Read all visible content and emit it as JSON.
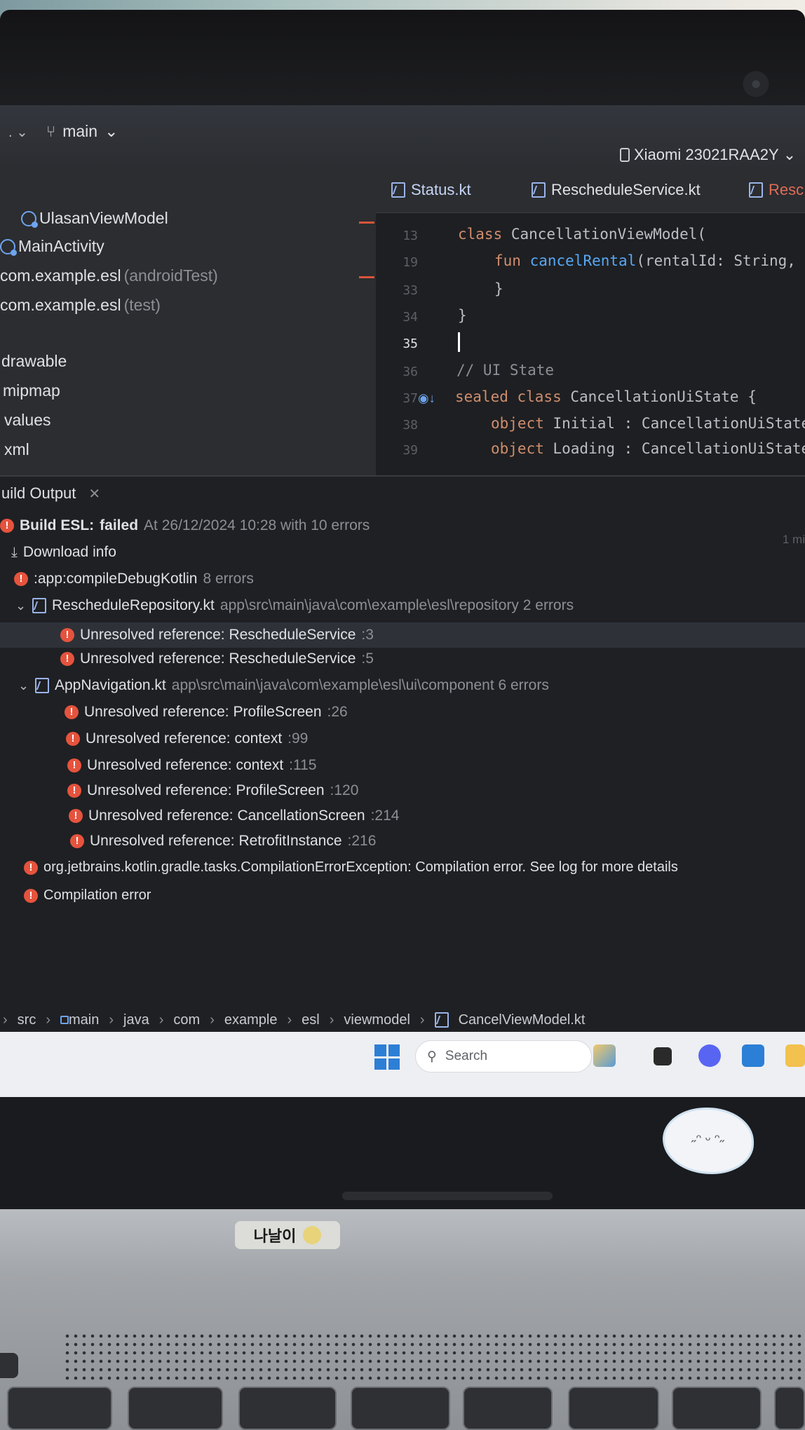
{
  "toolbar": {
    "branch": "main",
    "device": "Xiaomi 23021RAA2Y"
  },
  "project_tree": {
    "items": [
      {
        "label": "UlasanViewModel",
        "hint": ""
      },
      {
        "label": "MainActivity",
        "hint": ""
      },
      {
        "label": "com.example.esl",
        "hint": "(androidTest)"
      },
      {
        "label": "com.example.esl",
        "hint": "(test)"
      },
      {
        "label": "drawable",
        "hint": ""
      },
      {
        "label": "mipmap",
        "hint": ""
      },
      {
        "label": "values",
        "hint": ""
      },
      {
        "label": "xml",
        "hint": ""
      }
    ]
  },
  "editor": {
    "tabs": [
      "Status.kt",
      "RescheduleService.kt",
      "Resc"
    ],
    "gutter": [
      "13",
      "19",
      "33",
      "34",
      "35",
      "36",
      "37",
      "38",
      "39"
    ],
    "code": {
      "l13_kw": "class",
      "l13_rest": " CancellationViewModel(",
      "l19_kw": "fun",
      "l19_fn": "cancelRental",
      "l19_rest": "(rentalId: String,",
      "l33": "}",
      "l34": "}",
      "l36": "// UI State",
      "l37_kw": "sealed class",
      "l37_rest": " CancellationUiState {",
      "l38_kw": "object",
      "l38_rest": " Initial : CancellationUiState",
      "l39_kw": "object",
      "l39_rest": " Loading : CancellationUiState"
    }
  },
  "build_output": {
    "tab_label": "uild Output",
    "time_note": "1 mi",
    "summary": {
      "label": "Build ESL:",
      "status": "failed",
      "detail": "At 26/12/2024 10:28 with 10 errors"
    },
    "download_info": "Download info",
    "task": {
      "label": ":app:compileDebugKotlin",
      "count": "8 errors"
    },
    "files": [
      {
        "name": "RescheduleRepository.kt",
        "path": "app\\src\\main\\java\\com\\example\\esl\\repository 2 errors",
        "errors": [
          {
            "msg": "Unresolved reference: RescheduleService",
            "line": ":3"
          },
          {
            "msg": "Unresolved reference: RescheduleService",
            "line": ":5"
          }
        ]
      },
      {
        "name": "AppNavigation.kt",
        "path": "app\\src\\main\\java\\com\\example\\esl\\ui\\component 6 errors",
        "errors": [
          {
            "msg": "Unresolved reference: ProfileScreen",
            "line": ":26"
          },
          {
            "msg": "Unresolved reference: context",
            "line": ":99"
          },
          {
            "msg": "Unresolved reference: context",
            "line": ":115"
          },
          {
            "msg": "Unresolved reference: ProfileScreen",
            "line": ":120"
          },
          {
            "msg": "Unresolved reference: CancellationScreen",
            "line": ":214"
          },
          {
            "msg": "Unresolved reference: RetrofitInstance",
            "line": ":216"
          }
        ]
      }
    ],
    "exception": "org.jetbrains.kotlin.gradle.tasks.CompilationErrorException: Compilation error. See log for more details",
    "compilation_error": "Compilation error"
  },
  "breadcrumbs": [
    "src",
    "main",
    "java",
    "com",
    "example",
    "esl",
    "viewmodel",
    "CancelViewModel.kt"
  ],
  "taskbar": {
    "search_placeholder": "Search"
  },
  "laptop": {
    "name_sticker": "나날이"
  },
  "colors": {
    "error": "#e5533d",
    "keyword": "#cf8e6d",
    "function": "#56a8f5",
    "accent": "#6ea4ef"
  },
  "icons": [
    "branch-icon",
    "device-icon",
    "kotlin-class-icon",
    "kotlin-file-icon",
    "error-icon",
    "download-icon",
    "chevron-down-icon",
    "close-icon",
    "search-icon",
    "windows-icon"
  ]
}
